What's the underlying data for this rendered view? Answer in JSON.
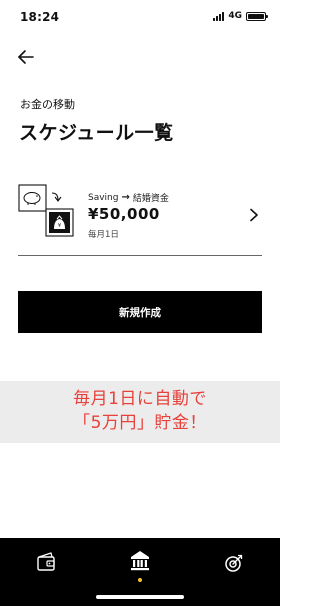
{
  "status_bar": {
    "time": "18:24",
    "network": "4G",
    "icons": [
      "signal-icon",
      "battery-icon"
    ]
  },
  "header": {
    "back_icon": "arrow-left-icon",
    "section_label": "お金の移動",
    "title": "スケジュール一覧"
  },
  "schedules": [
    {
      "from": "Saving",
      "arrow": "→",
      "to": "結婚資金",
      "amount": "¥50,000",
      "date": "毎月1日",
      "icon": "transfer-icon"
    }
  ],
  "actions": {
    "create_label": "新規作成"
  },
  "annotation": {
    "line1": "毎月1日に自動で",
    "line2": "「5万円」貯金！",
    "color": "#e8403a"
  },
  "bottom_nav": {
    "items": [
      {
        "icon": "wallet-icon",
        "active": false
      },
      {
        "icon": "bank-icon",
        "active": true
      },
      {
        "icon": "goal-icon",
        "active": false
      }
    ],
    "active_dot_color": "#f2c230"
  },
  "colors": {
    "primary": "#000000",
    "background": "#ffffff",
    "banner_background": "#ececec"
  }
}
